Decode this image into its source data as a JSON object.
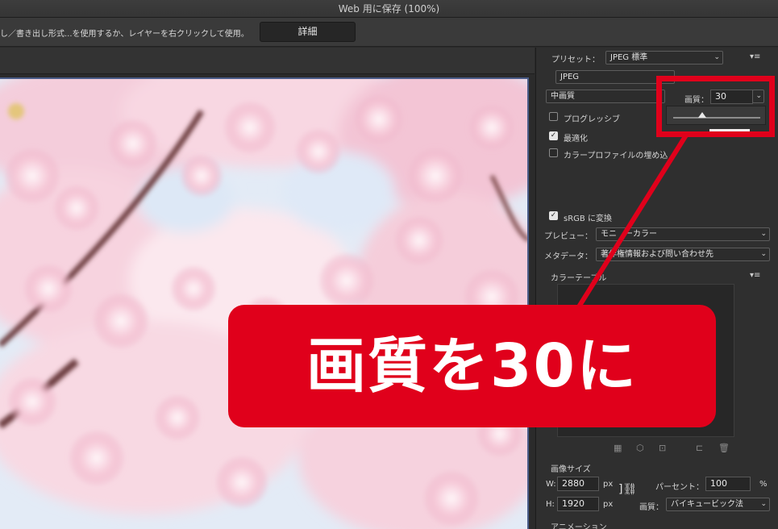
{
  "window": {
    "title": "Web 用に保存 (100%)"
  },
  "topbar": {
    "hint": "し／書き出し形式...を使用するか、レイヤーを右クリックして使用。",
    "detail_label": "詳細"
  },
  "settings": {
    "preset_label": "プリセット：",
    "preset_value": "JPEG 標準",
    "format_value": "JPEG",
    "quality_level_value": "中画質",
    "quality_label": "画質：",
    "quality_value": "30",
    "quality_slider_fraction": 0.3,
    "progressive_label": "プログレッシブ",
    "progressive_checked": false,
    "optimize_label": "最適化",
    "optimize_checked": true,
    "embed_profile_label": "カラープロファイルの埋め込",
    "embed_profile_checked": false,
    "srgb_label": "sRGB に変換",
    "srgb_checked": true,
    "preview_label": "プレビュー：",
    "preview_value": "モニ　ーカラー",
    "metadata_label": "メタデータ：",
    "metadata_value": "著作権情報および問い合わせ先",
    "color_table_label": "カラーテーブル"
  },
  "image_size": {
    "heading": "画像サイズ",
    "width_label": "W:",
    "width_value": "2880",
    "height_label": "H:",
    "height_value": "1920",
    "unit": "px",
    "percent_label": "パーセント：",
    "percent_value": "100",
    "percent_unit": "%",
    "resample_label": "画質：",
    "resample_value": "バイキュービック法"
  },
  "animation": {
    "heading": "アニメーション"
  },
  "annotation": {
    "banner_text": "画質を30に",
    "color": "#e0001b"
  }
}
